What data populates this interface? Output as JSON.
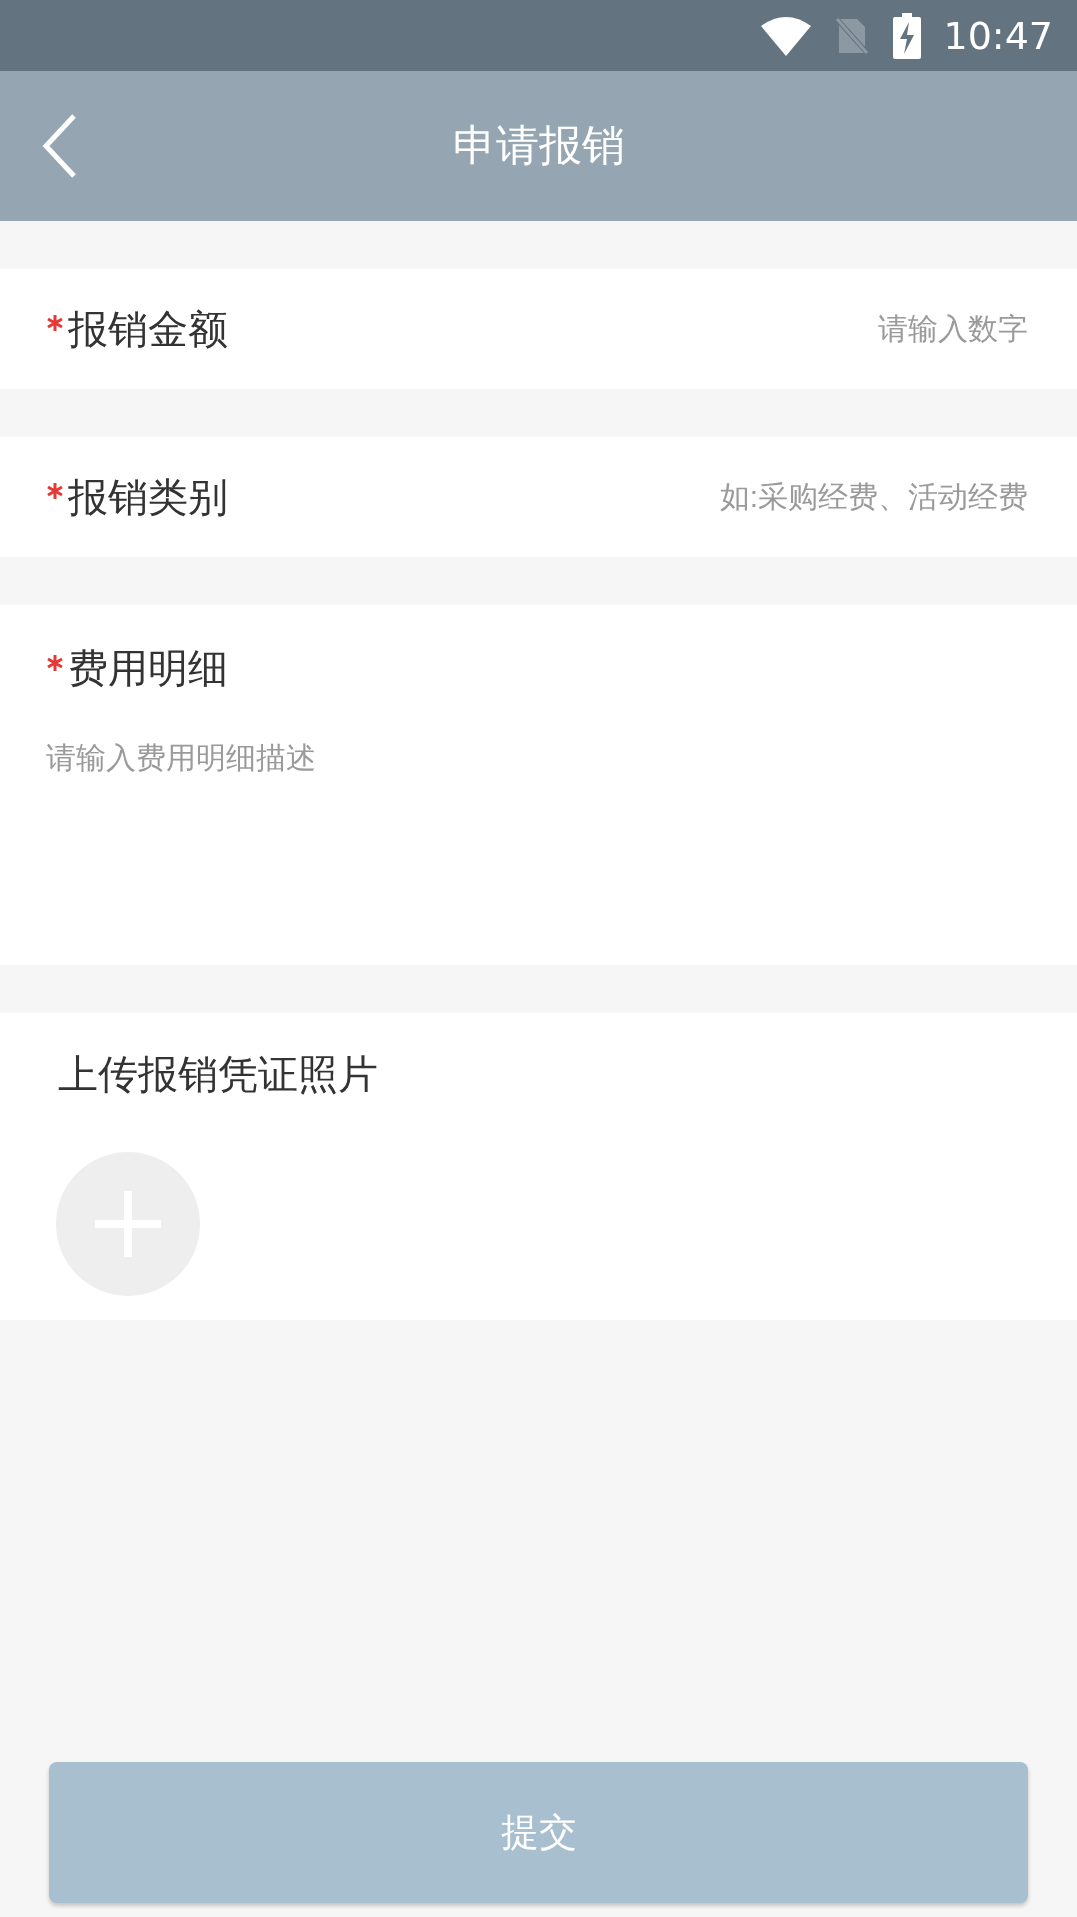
{
  "status_bar": {
    "time": "10:47"
  },
  "header": {
    "title": "申请报销"
  },
  "fields": [
    {
      "kind": "inline",
      "label": "报销金额",
      "required": true,
      "placeholder": "请输入数字"
    },
    {
      "kind": "inline",
      "label": "报销类别",
      "required": true,
      "placeholder": "如:采购经费、活动经费"
    },
    {
      "kind": "multiline",
      "label": "费用明细",
      "required": true,
      "placeholder": "请输入费用明细描述"
    }
  ],
  "upload": {
    "title": "上传报销凭证照片"
  },
  "submit_button": {
    "label": "提交"
  }
}
